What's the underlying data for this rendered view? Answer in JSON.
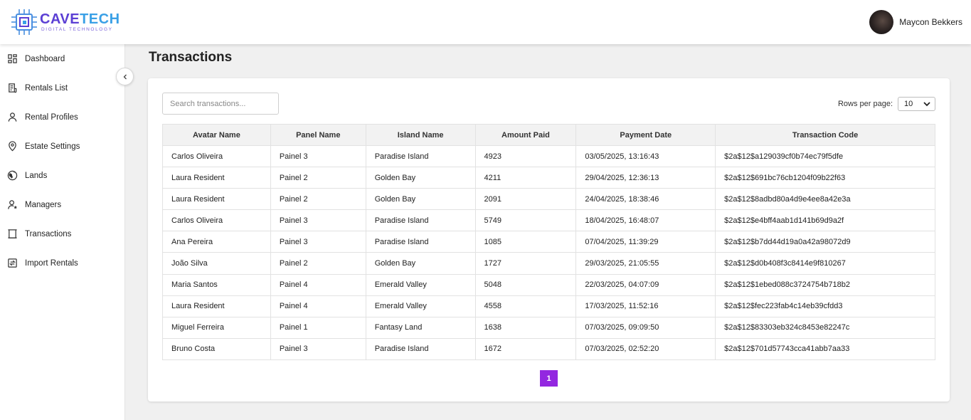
{
  "brand": {
    "name_part1": "CAVE",
    "name_part2": "TECH",
    "tagline": "DIGITAL TECHNOLOGY",
    "primary_color": "#5b3fd4",
    "accent_color": "#3aa0e6"
  },
  "user": {
    "name": "Maycon Bekkers"
  },
  "sidebar": {
    "items": [
      {
        "label": "Dashboard",
        "icon": "dashboard-icon"
      },
      {
        "label": "Rentals List",
        "icon": "list-icon"
      },
      {
        "label": "Rental Profiles",
        "icon": "user-icon"
      },
      {
        "label": "Estate Settings",
        "icon": "location-pin-icon"
      },
      {
        "label": "Lands",
        "icon": "globe-icon"
      },
      {
        "label": "Managers",
        "icon": "manager-icon"
      },
      {
        "label": "Transactions",
        "icon": "receipt-icon"
      },
      {
        "label": "Import Rentals",
        "icon": "import-icon"
      }
    ]
  },
  "page": {
    "title": "Transactions"
  },
  "search": {
    "placeholder": "Search transactions..."
  },
  "rows_per_page": {
    "label": "Rows per page:",
    "value": "10"
  },
  "table": {
    "columns": [
      "Avatar Name",
      "Panel Name",
      "Island Name",
      "Amount Paid",
      "Payment Date",
      "Transaction Code"
    ],
    "rows": [
      [
        "Carlos Oliveira",
        "Painel 3",
        "Paradise Island",
        "4923",
        "03/05/2025, 13:16:43",
        "$2a$12$a129039cf0b74ec79f5dfe"
      ],
      [
        "Laura Resident",
        "Painel 2",
        "Golden Bay",
        "4211",
        "29/04/2025, 12:36:13",
        "$2a$12$691bc76cb1204f09b22f63"
      ],
      [
        "Laura Resident",
        "Painel 2",
        "Golden Bay",
        "2091",
        "24/04/2025, 18:38:46",
        "$2a$12$8adbd80a4d9e4ee8a42e3a"
      ],
      [
        "Carlos Oliveira",
        "Painel 3",
        "Paradise Island",
        "5749",
        "18/04/2025, 16:48:07",
        "$2a$12$e4bff4aab1d141b69d9a2f"
      ],
      [
        "Ana Pereira",
        "Painel 3",
        "Paradise Island",
        "1085",
        "07/04/2025, 11:39:29",
        "$2a$12$b7dd44d19a0a42a98072d9"
      ],
      [
        "João Silva",
        "Painel 2",
        "Golden Bay",
        "1727",
        "29/03/2025, 21:05:55",
        "$2a$12$d0b408f3c8414e9f810267"
      ],
      [
        "Maria Santos",
        "Painel 4",
        "Emerald Valley",
        "5048",
        "22/03/2025, 04:07:09",
        "$2a$12$1ebed088c3724754b718b2"
      ],
      [
        "Laura Resident",
        "Painel 4",
        "Emerald Valley",
        "4558",
        "17/03/2025, 11:52:16",
        "$2a$12$fec223fab4c14eb39cfdd3"
      ],
      [
        "Miguel Ferreira",
        "Painel 1",
        "Fantasy Land",
        "1638",
        "07/03/2025, 09:09:50",
        "$2a$12$83303eb324c8453e82247c"
      ],
      [
        "Bruno Costa",
        "Painel 3",
        "Paradise Island",
        "1672",
        "07/03/2025, 02:52:20",
        "$2a$12$701d57743cca41abb7aa33"
      ]
    ]
  },
  "pagination": {
    "current": "1",
    "active_color": "#9327e0"
  }
}
